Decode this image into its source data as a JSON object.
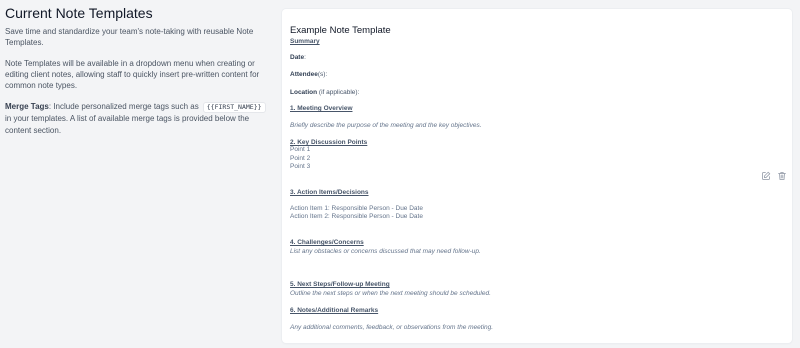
{
  "page": {
    "heading": "Current Note Templates",
    "intro": "Save time and standardize your team's note-taking with reusable Note Templates.",
    "dropdown_info": "Note Templates will be available in a dropdown menu when creating or editing client notes, allowing staff to quickly insert pre-written content for common note types.",
    "merge_tags": {
      "label": "Merge Tags",
      "text_before": ": Include personalized merge tags such as",
      "example_tag": "{{FIRST_NAME}}",
      "text_after": "in your templates. A list of available merge tags is provided below the content section."
    }
  },
  "template": {
    "title": "Example Note Template",
    "summary_heading": "Summary",
    "date_label": "Date",
    "date_suffix": ":",
    "attendee_label": "Attendee",
    "attendee_suffix": "(s):",
    "location_label": "Location",
    "location_suffix": " (if applicable):",
    "sections": [
      {
        "heading": "1. Meeting Overview",
        "text": "Briefly describe the purpose of the meeting and the key objectives."
      },
      {
        "heading": "2. Key Discussion Points",
        "points": [
          "Point 1",
          "Point 2",
          "Point 3"
        ]
      },
      {
        "heading": "3. Action Items/Decisions",
        "points": [
          "Action Item 1: Responsible Person - Due Date",
          "Action Item 2: Responsible Person - Due Date"
        ]
      },
      {
        "heading": "4. Challenges/Concerns",
        "text": "List any obstacles or concerns discussed that may need follow-up."
      },
      {
        "heading": "5. Next Steps/Follow-up Meeting",
        "text": "Outline the next steps or when the next meeting should be scheduled."
      },
      {
        "heading": "6. Notes/Additional Remarks",
        "text": "Any additional comments, feedback, or observations from the meeting."
      }
    ]
  },
  "actions": {
    "edit_icon": "edit-icon",
    "delete_icon": "trash-icon"
  },
  "colors": {
    "background": "#f3f4f6",
    "card": "#ffffff",
    "heading_text": "#475569",
    "icon": "#9ca3af"
  }
}
